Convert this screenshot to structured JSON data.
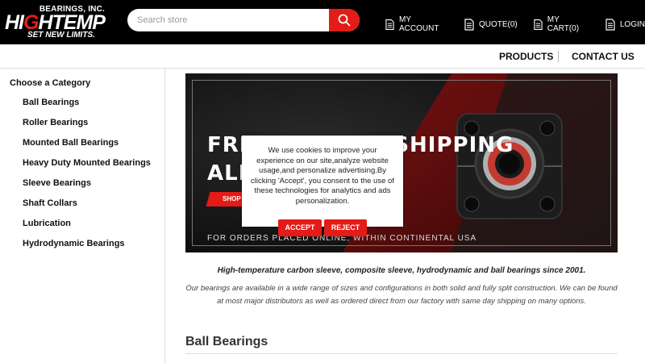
{
  "logo": {
    "company_suffix": "BEARINGS, INC.",
    "name_part1": "HI",
    "name_red": "G",
    "name_part2": "HTEMP",
    "tagline": "SET NEW LIMITS."
  },
  "search": {
    "placeholder": "Search store",
    "value": ""
  },
  "toplinks": {
    "account": "MY ACCOUNT",
    "quote": "QUOTE(0)",
    "cart": "MY CART(0)",
    "login": "LOGIN"
  },
  "mainnav": {
    "products": "PRODUCTS",
    "contact": "CONTACT US"
  },
  "sidebar": {
    "title": "Choose a Category",
    "items": [
      "Ball Bearings",
      "Roller Bearings",
      "Mounted Ball Bearings",
      "Heavy Duty Mounted Bearings",
      "Sleeve Bearings",
      "Shaft Collars",
      "Lubrication",
      "Hydrodynamic Bearings"
    ]
  },
  "banner": {
    "headline_line1": "FREE GROUND SHIPPING",
    "headline_line2": "ALL ORDERS",
    "shop_label": "SHOP NOW",
    "fine_print": "FOR ORDERS PLACED ONLINE, WITHIN CONTINENTAL USA"
  },
  "cookie": {
    "message": "We use cookies to improve your experience on our site,analyze website usage,and personalize advertising.By clicking 'Accept', you consent to the use of these technologies for analytics and ads personalization.",
    "accept": "ACCEPT",
    "reject": "REJECT"
  },
  "intro": {
    "tagline": "High-temperature carbon sleeve, composite sleeve, hydrodynamic and ball bearings since 2001.",
    "description": "Our bearings are available in a wide range of sizes and configurations in both solid and fully split construction. We can be found at most major distributors as well as ordered direct from our factory with same day shipping on many options."
  },
  "section": {
    "heading": "Ball Bearings"
  },
  "colors": {
    "brand_red": "#e41b17",
    "header_bg": "#000000"
  },
  "icons": [
    "search-icon",
    "document-icon"
  ]
}
